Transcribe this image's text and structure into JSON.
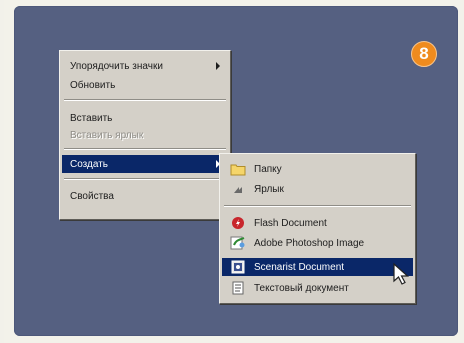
{
  "badge": {
    "number": "8",
    "color": "#ef8b1e"
  },
  "context_menu": {
    "items": [
      {
        "label": "Упорядочить значки",
        "submenu": true,
        "enabled": true
      },
      {
        "label": "Обновить",
        "enabled": true
      },
      {
        "label": "Вставить",
        "enabled": true
      },
      {
        "label": "Вставить ярлык",
        "enabled": false
      },
      {
        "label": "Создать",
        "submenu": true,
        "enabled": true,
        "highlighted": true
      },
      {
        "label": "Свойства",
        "enabled": true
      }
    ]
  },
  "create_submenu": {
    "items": [
      {
        "label": "Папку",
        "icon": "folder-icon"
      },
      {
        "label": "Ярлык",
        "icon": "shortcut-icon"
      },
      {
        "label": "Flash Document",
        "icon": "flash-document-icon"
      },
      {
        "label": "Adobe Photoshop Image",
        "icon": "photoshop-image-icon"
      },
      {
        "label": "Scenarist Document",
        "icon": "scenarist-document-icon",
        "highlighted": true
      },
      {
        "label": "Текстовый документ",
        "icon": "text-document-icon"
      }
    ]
  },
  "colors": {
    "desktop": "#556081",
    "menu_face": "#d4d0c8",
    "highlight": "#0a2768"
  }
}
